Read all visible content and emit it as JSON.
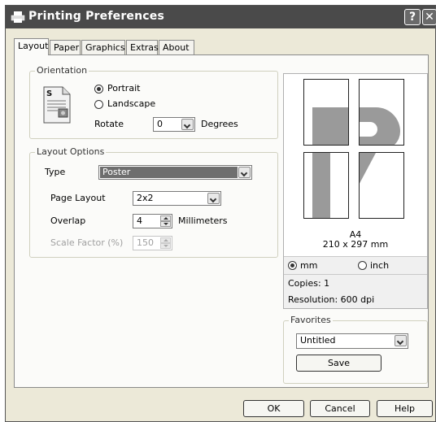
{
  "window": {
    "title": "Printing Preferences",
    "help_btn": "?",
    "close_btn": "✕"
  },
  "tabs": [
    {
      "label": "Layout",
      "active": true
    },
    {
      "label": "Paper"
    },
    {
      "label": "Graphics"
    },
    {
      "label": "Extras"
    },
    {
      "label": "About"
    }
  ],
  "orientation": {
    "group_label": "Orientation",
    "portrait_label": "Portrait",
    "landscape_label": "Landscape",
    "selected": "Portrait",
    "rotate_label": "Rotate",
    "rotate_value": "0",
    "degrees_label": "Degrees"
  },
  "layout_options": {
    "group_label": "Layout Options",
    "type_label": "Type",
    "type_value": "Poster",
    "page_layout_label": "Page Layout",
    "page_layout_value": "2x2",
    "overlap_label": "Overlap",
    "overlap_value": "4",
    "overlap_unit": "Millimeters",
    "scale_factor_label": "Scale Factor (%)",
    "scale_factor_value": "150"
  },
  "preview": {
    "paper_name": "A4",
    "paper_size": "210 x 297 mm",
    "unit_mm_label": "mm",
    "unit_inch_label": "inch",
    "selected_unit": "mm",
    "copies": "Copies: 1",
    "resolution": "Resolution: 600 dpi"
  },
  "favorites": {
    "group_label": "Favorites",
    "selected": "Untitled",
    "save_label": "Save"
  },
  "buttons": {
    "ok": "OK",
    "cancel": "Cancel",
    "help": "Help"
  },
  "colors": {
    "titlebar": "#4a4a4a",
    "dialog_bg": "#ece9d8",
    "panel_bg": "#fbfbf9",
    "selection": "#6e6e6e",
    "preview_glyph": "#9a9a9a"
  }
}
